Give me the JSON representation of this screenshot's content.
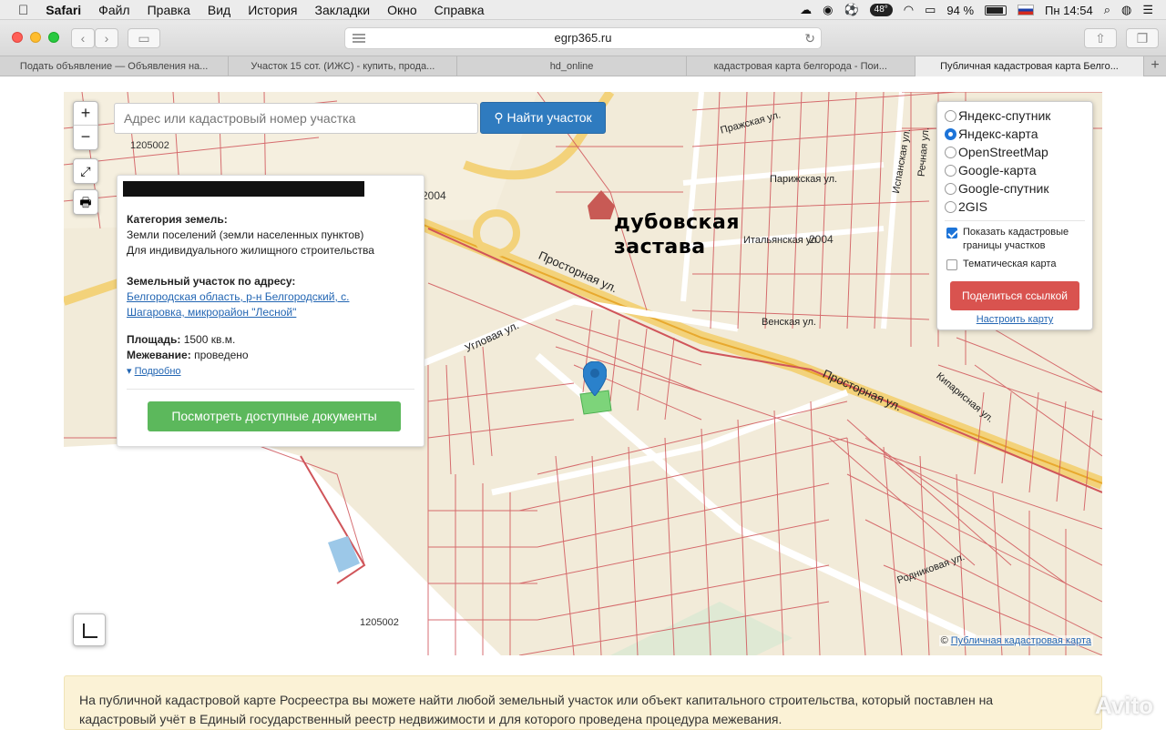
{
  "menubar": {
    "apple": "",
    "app": "Safari",
    "items": [
      "Файл",
      "Правка",
      "Вид",
      "История",
      "Закладки",
      "Окно",
      "Справка"
    ],
    "temperature": "48°",
    "battery": "94 %",
    "clock": "Пн 14:54"
  },
  "toolbar": {
    "url": "egrp365.ru"
  },
  "tabs": [
    "Подать объявление — Объявления на...",
    "Участок 15 сот. (ИЖС) - купить, прода...",
    "hd_online",
    "кадастровая карта белгорода - Пои...",
    "Публичная кадастровая карта Белго..."
  ],
  "map": {
    "search_placeholder": "Адрес или кадастровый номер участка",
    "search_button": "Найти участок",
    "zoom_in": "+",
    "zoom_out": "−",
    "overlay_label_line1": "дубовская",
    "overlay_label_line2": "застава",
    "streets": [
      "Просторная ул.",
      "Угловая ул.",
      "Пражская ул.",
      "Парижская ул.",
      "Итальянская ул.",
      "Венская ул.",
      "Родниковая ул.",
      "Испанская ул.",
      "Речная ул.",
      "Кипарисная ул."
    ],
    "quarters": [
      "1205002",
      "1205002",
      "2004",
      "2004"
    ],
    "attribution_prefix": "©",
    "attribution_link": "Публичная кадастровая карта"
  },
  "info_panel": {
    "category_title": "Категория земель:",
    "category_line1": "Земли поселений (земли населенных пунктов)",
    "category_line2": "Для индивидуального жилищного строительства",
    "address_title": "Земельный участок по адресу:",
    "address_line1": "Белгородская область, р-н Белгородский, с.",
    "address_line2": "Шагаровка, микрорайон \"Лесной\"",
    "area_title": "Площадь:",
    "area_value": "1500 кв.м.",
    "survey_title": "Межевание:",
    "survey_value": "проведено",
    "details_link": "Подробно",
    "docs_button": "Посмотреть доступные документы"
  },
  "layers": {
    "options": [
      "Яндекс-спутник",
      "Яндекс-карта",
      "OpenStreetMap",
      "Google-карта",
      "Google-спутник",
      "2GIS"
    ],
    "selected": "Яндекс-карта",
    "checkbox_borders_line1": "Показать кадастровые",
    "checkbox_borders_line2": "границы участков",
    "checkbox_thematic": "Тематическая карта",
    "share_button": "Поделиться ссылкой",
    "configure_link": "Настроить карту"
  },
  "note": {
    "line1": "На публичной кадастровой карте Росреестра вы можете найти любой земельный участок или объект капитального строительства, который поставлен на",
    "line2": "кадастровый учёт в Единый государственный реестр недвижимости и для которого проведена процедура межевания."
  },
  "watermark": "Avito",
  "colors": {
    "accent_blue": "#2f7bbf",
    "green_button": "#5cb85c",
    "red_button": "#d9534f",
    "parcel_line": "#d0555a"
  }
}
